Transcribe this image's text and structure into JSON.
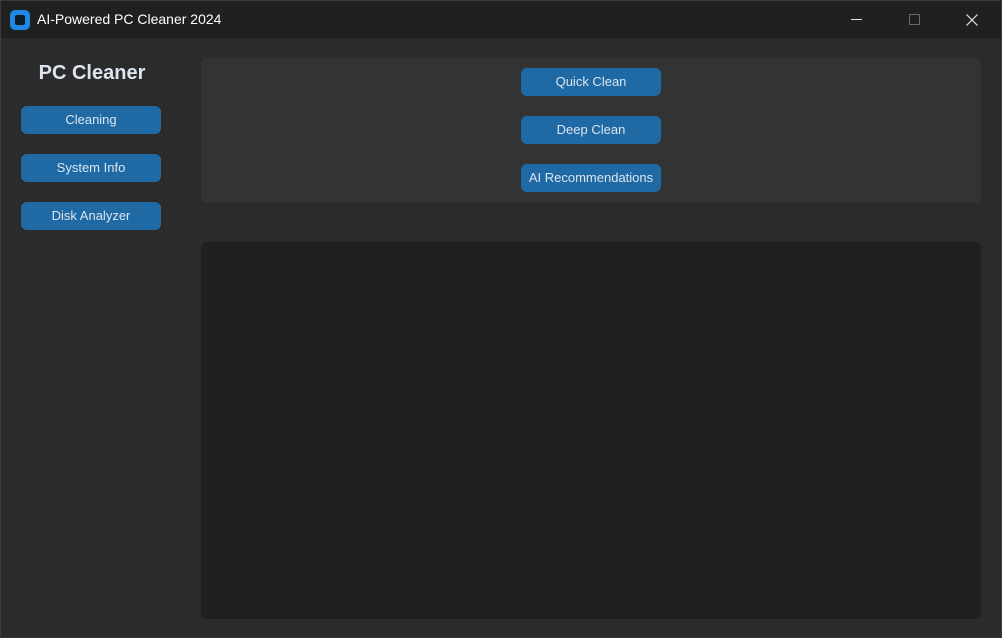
{
  "window": {
    "title": "AI-Powered PC Cleaner 2024",
    "icon": "app-icon",
    "controls": {
      "minimize_icon": "minimize-icon",
      "maximize_icon": "maximize-icon",
      "close_icon": "close-icon",
      "close_glyph": "✕"
    }
  },
  "sidebar": {
    "title": "PC Cleaner",
    "items": [
      {
        "label": "Cleaning"
      },
      {
        "label": "System Info"
      },
      {
        "label": "Disk Analyzer"
      }
    ]
  },
  "actions": {
    "buttons": [
      {
        "label": "Quick Clean"
      },
      {
        "label": "Deep Clean"
      },
      {
        "label": "AI Recommendations"
      }
    ]
  },
  "output": {
    "text": ""
  },
  "colors": {
    "background": "#2b2b2b",
    "titlebar": "#202020",
    "button": "#1f6aa5",
    "button_text": "#dce4ee",
    "panel": "#333333",
    "output_panel": "#1f201f",
    "app_icon": "#1e88e5"
  }
}
